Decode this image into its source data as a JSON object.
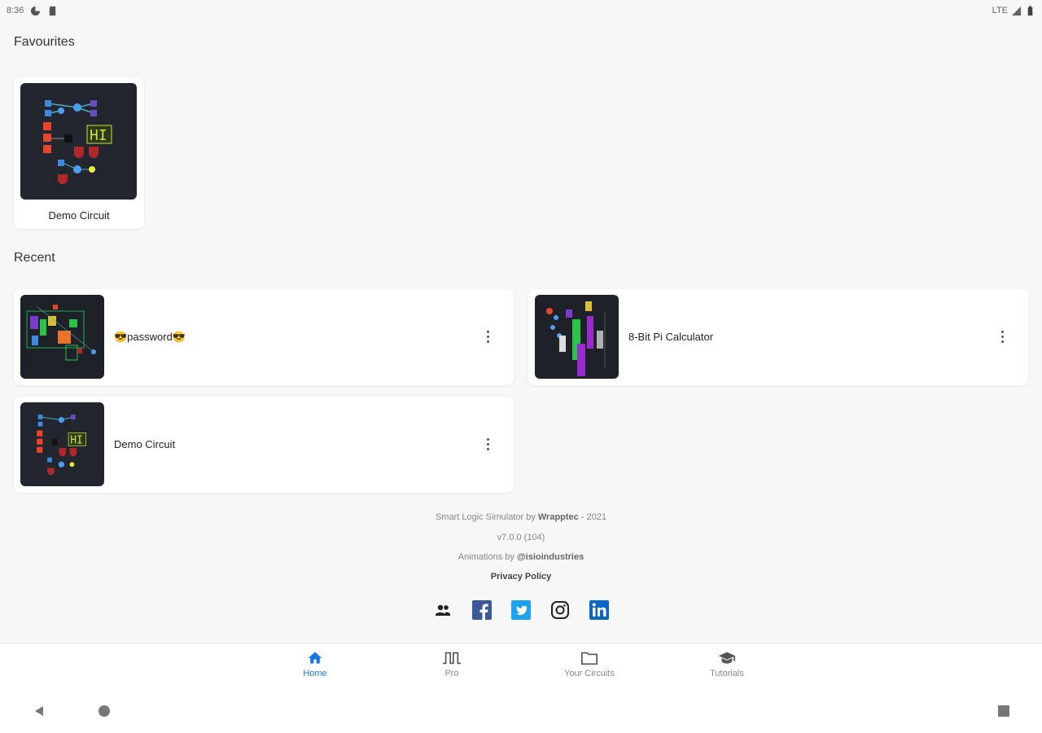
{
  "status_bar": {
    "time": "8:36",
    "network": "LTE"
  },
  "sections": {
    "favourites_title": "Favourites",
    "recent_title": "Recent"
  },
  "favourites": [
    {
      "label": "Demo Circuit"
    }
  ],
  "recent": [
    {
      "label": "😎password😎"
    },
    {
      "label": "8-Bit Pi Calculator"
    },
    {
      "label": "Demo Circuit"
    }
  ],
  "footer": {
    "credit_prefix": "Smart Logic Simulator by ",
    "credit_brand": "Wrapptec",
    "credit_suffix": " - 2021",
    "version": "v7.0.0 (104)",
    "animations_prefix": "Animations by ",
    "animations_author": "@isioindustries",
    "privacy": "Privacy Policy"
  },
  "socials": [
    "community-icon",
    "facebook-icon",
    "twitter-icon",
    "instagram-icon",
    "linkedin-icon"
  ],
  "bottom_nav": {
    "home": "Home",
    "pro": "Pro",
    "your_circuits": "Your Circuits",
    "tutorials": "Tutorials"
  },
  "colors": {
    "accent": "#1a73e8",
    "facebook": "#3b5998",
    "twitter": "#1da1f2",
    "linkedin": "#0a66c2"
  }
}
